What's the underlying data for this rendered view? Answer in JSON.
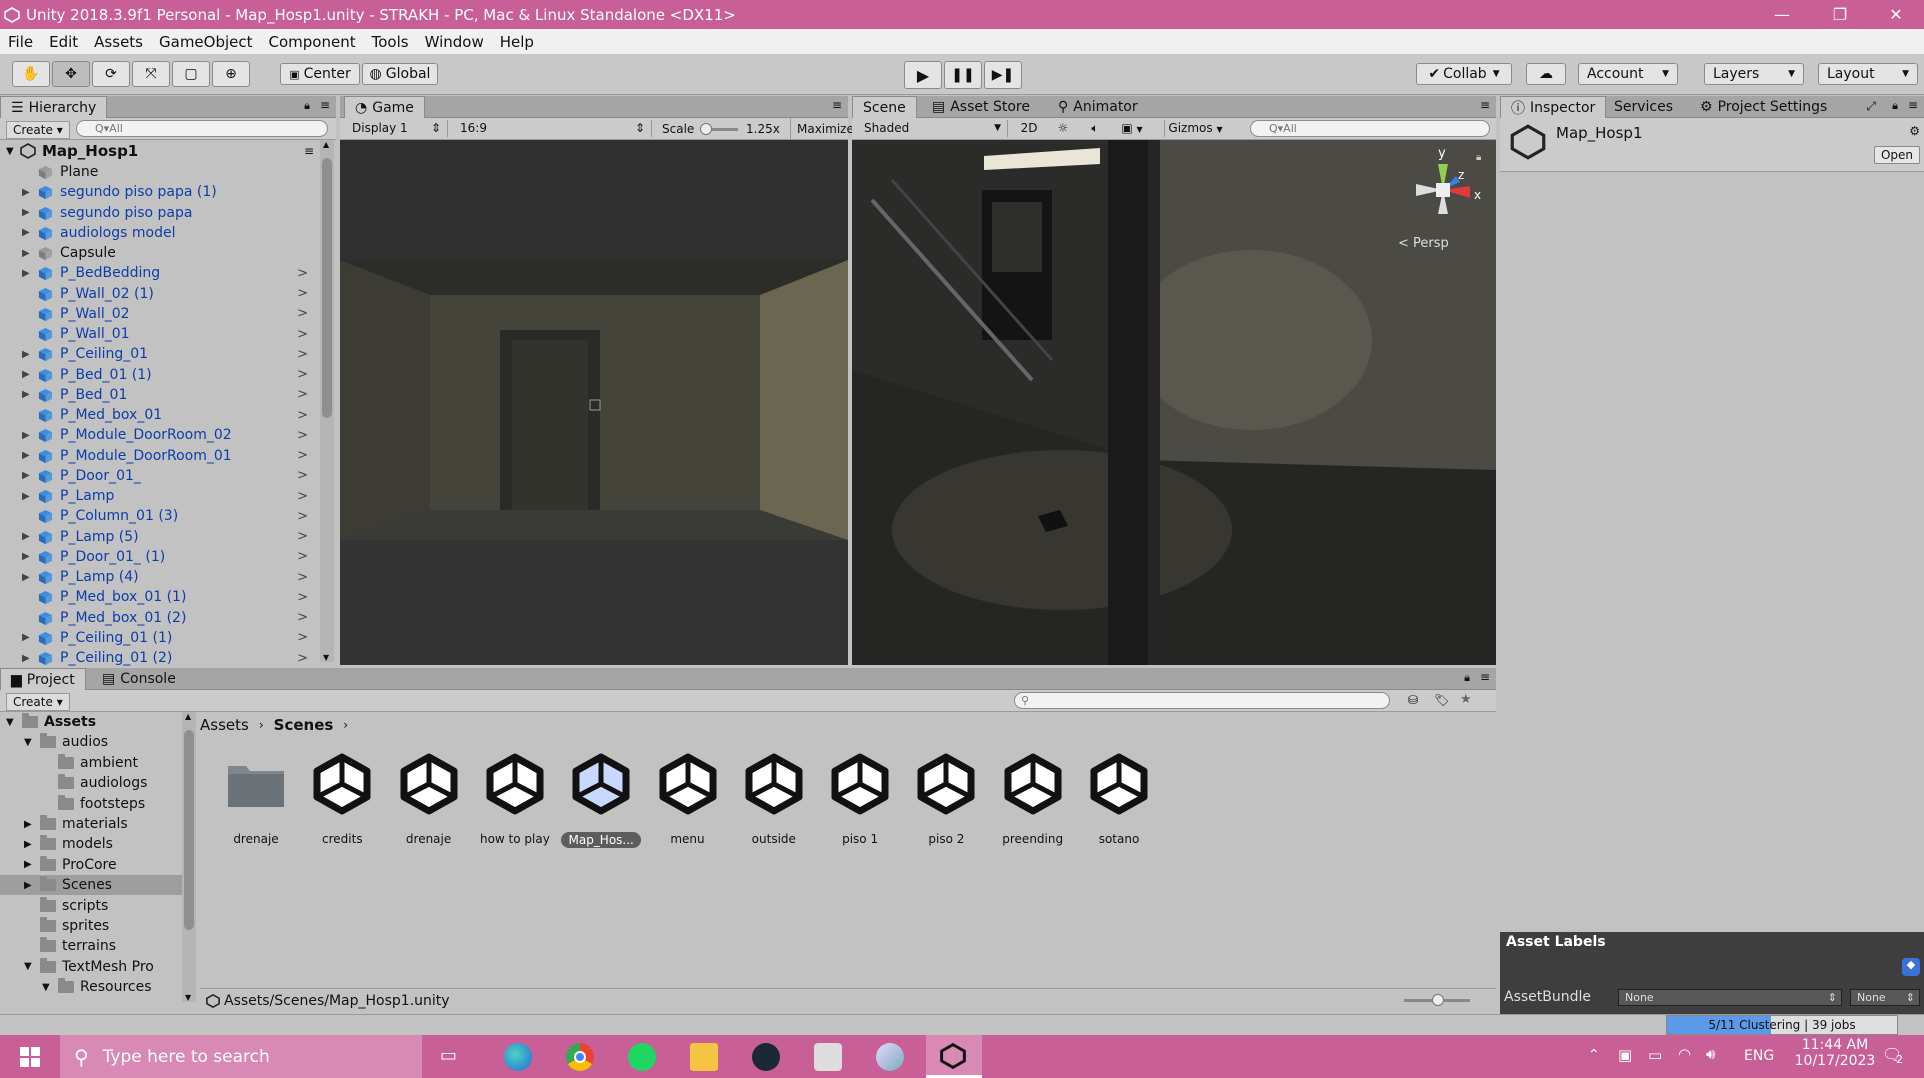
{
  "window": {
    "title": "Unity 2018.3.9f1 Personal - Map_Hosp1.unity - STRAKH - PC, Mac & Linux Standalone <DX11>",
    "controls": [
      "—",
      "❐",
      "✕"
    ]
  },
  "menu": [
    "File",
    "Edit",
    "Assets",
    "GameObject",
    "Component",
    "Tools",
    "Window",
    "Help"
  ],
  "toolbar": {
    "pivot": "Center",
    "space": "Global",
    "collab": "Collab",
    "account": "Account",
    "layers": "Layers",
    "layout": "Layout"
  },
  "hierarchy": {
    "tab": "Hierarchy",
    "create": "Create",
    "search_placeholder": "Q▾All",
    "scene_name": "Map_Hosp1",
    "items": [
      {
        "label": "Plane",
        "arrow": "",
        "more": "",
        "prefab": false
      },
      {
        "label": "segundo piso papa (1)",
        "arrow": "▶",
        "more": "",
        "prefab": true
      },
      {
        "label": "segundo piso papa",
        "arrow": "▶",
        "more": "",
        "prefab": true
      },
      {
        "label": "audiologs model",
        "arrow": "▶",
        "more": "",
        "prefab": true
      },
      {
        "label": "Capsule",
        "arrow": "▶",
        "more": "",
        "prefab": false
      },
      {
        "label": "P_BedBedding",
        "arrow": "▶",
        "more": ">",
        "prefab": true
      },
      {
        "label": "P_Wall_02 (1)",
        "arrow": "",
        "more": ">",
        "prefab": true
      },
      {
        "label": "P_Wall_02",
        "arrow": "",
        "more": ">",
        "prefab": true
      },
      {
        "label": "P_Wall_01",
        "arrow": "",
        "more": ">",
        "prefab": true
      },
      {
        "label": "P_Ceiling_01",
        "arrow": "▶",
        "more": ">",
        "prefab": true
      },
      {
        "label": "P_Bed_01 (1)",
        "arrow": "▶",
        "more": ">",
        "prefab": true
      },
      {
        "label": "P_Bed_01",
        "arrow": "▶",
        "more": ">",
        "prefab": true
      },
      {
        "label": "P_Med_box_01",
        "arrow": "",
        "more": ">",
        "prefab": true
      },
      {
        "label": "P_Module_DoorRoom_02",
        "arrow": "▶",
        "more": ">",
        "prefab": true
      },
      {
        "label": "P_Module_DoorRoom_01",
        "arrow": "▶",
        "more": ">",
        "prefab": true
      },
      {
        "label": "P_Door_01_",
        "arrow": "▶",
        "more": ">",
        "prefab": true
      },
      {
        "label": "P_Lamp",
        "arrow": "▶",
        "more": ">",
        "prefab": true
      },
      {
        "label": "P_Column_01 (3)",
        "arrow": "",
        "more": ">",
        "prefab": true
      },
      {
        "label": "P_Lamp (5)",
        "arrow": "▶",
        "more": ">",
        "prefab": true
      },
      {
        "label": "P_Door_01_ (1)",
        "arrow": "▶",
        "more": ">",
        "prefab": true
      },
      {
        "label": "P_Lamp (4)",
        "arrow": "▶",
        "more": ">",
        "prefab": true
      },
      {
        "label": "P_Med_box_01 (1)",
        "arrow": "",
        "more": ">",
        "prefab": true
      },
      {
        "label": "P_Med_box_01 (2)",
        "arrow": "",
        "more": ">",
        "prefab": true
      },
      {
        "label": "P_Ceiling_01 (1)",
        "arrow": "▶",
        "more": ">",
        "prefab": true
      },
      {
        "label": "P_Ceiling_01 (2)",
        "arrow": "▶",
        "more": ">",
        "prefab": true
      }
    ]
  },
  "game": {
    "tab": "Game",
    "display": "Display 1",
    "aspect": "16:9",
    "scale_label": "Scale",
    "scale_value": "1.25x",
    "maximize": "Maximize"
  },
  "scene": {
    "tabs": [
      "Scene",
      "Asset Store",
      "Animator"
    ],
    "shading": "Shaded",
    "mode2d": "2D",
    "gizmos": "Gizmos",
    "search_placeholder": "Q▾All",
    "persp": "< Persp",
    "axis_y": "y",
    "axis_z": "z",
    "axis_x": "x"
  },
  "inspector": {
    "tabs": [
      "Inspector",
      "Services",
      "Project Settings"
    ],
    "object_name": "Map_Hosp1",
    "open": "Open",
    "asset_labels": "Asset Labels",
    "assetbundle_label": "AssetBundle",
    "assetbundle_value": "None",
    "variant_value": "None"
  },
  "project": {
    "tabs": [
      "Project",
      "Console"
    ],
    "create": "Create",
    "breadcrumb": [
      "Assets",
      "Scenes"
    ],
    "tree": [
      {
        "label": "Assets",
        "level": 0,
        "arrow": "▼",
        "bold": true
      },
      {
        "label": "audios",
        "level": 1,
        "arrow": "▼",
        "bold": false
      },
      {
        "label": "ambient",
        "level": 2,
        "arrow": "",
        "bold": false
      },
      {
        "label": "audiologs",
        "level": 2,
        "arrow": "",
        "bold": false
      },
      {
        "label": "footsteps",
        "level": 2,
        "arrow": "",
        "bold": false
      },
      {
        "label": "materials",
        "level": 1,
        "arrow": "▶",
        "bold": false
      },
      {
        "label": "models",
        "level": 1,
        "arrow": "▶",
        "bold": false
      },
      {
        "label": "ProCore",
        "level": 1,
        "arrow": "▶",
        "bold": false
      },
      {
        "label": "Scenes",
        "level": 1,
        "arrow": "▶",
        "bold": false,
        "selected": true
      },
      {
        "label": "scripts",
        "level": 1,
        "arrow": "",
        "bold": false
      },
      {
        "label": "sprites",
        "level": 1,
        "arrow": "",
        "bold": false
      },
      {
        "label": "terrains",
        "level": 1,
        "arrow": "",
        "bold": false
      },
      {
        "label": "TextMesh Pro",
        "level": 1,
        "arrow": "▼",
        "bold": false
      },
      {
        "label": "Resources",
        "level": 2,
        "arrow": "▼",
        "bold": false
      }
    ],
    "assets": [
      {
        "name": "drenaje",
        "kind": "folder"
      },
      {
        "name": "credits",
        "kind": "scene"
      },
      {
        "name": "drenaje",
        "kind": "scene"
      },
      {
        "name": "how to play",
        "kind": "scene"
      },
      {
        "name": "Map_Hos...",
        "kind": "scene",
        "selected": true
      },
      {
        "name": "menu",
        "kind": "scene"
      },
      {
        "name": "outside",
        "kind": "scene"
      },
      {
        "name": "piso 1",
        "kind": "scene"
      },
      {
        "name": "piso 2",
        "kind": "scene"
      },
      {
        "name": "preending",
        "kind": "scene"
      },
      {
        "name": "sotano",
        "kind": "scene"
      }
    ],
    "path": "Assets/Scenes/Map_Hosp1.unity"
  },
  "status": {
    "progress_text": "5/11 Clustering | 39 jobs",
    "progress_fraction": 0.45
  },
  "taskbar": {
    "search_placeholder": "Type here to search",
    "lang": "ENG",
    "time": "11:44 AM",
    "date": "10/17/2023",
    "notif_count": "2"
  },
  "colors": {
    "titlebar": "#c85f96",
    "taskbar": "#c85f96",
    "prefab_text": "#0c3ea8",
    "selection": "#3a72d8",
    "editor_bg": "#c2c2c2"
  }
}
